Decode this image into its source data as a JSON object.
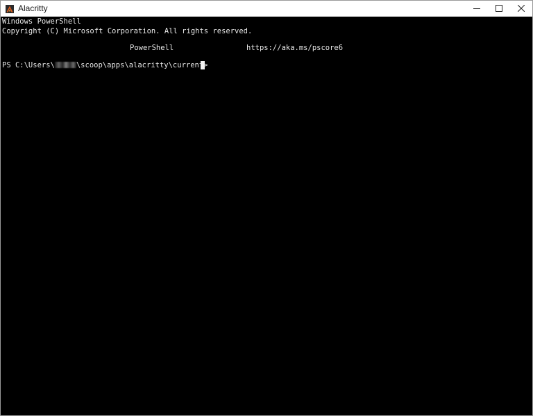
{
  "window": {
    "title": "Alacritty",
    "controls": {
      "minimize_icon": "minimize-icon",
      "maximize_icon": "maximize-icon",
      "close_icon": "close-icon"
    },
    "app_icon": "alacritty-logo-icon",
    "accent_color": "#e05c1e"
  },
  "terminal": {
    "background": "#000000",
    "foreground": "#e8e8e8",
    "lines": {
      "line1": "Windows PowerShell",
      "line2": "Copyright (C) Microsoft Corporation. All rights reserved.",
      "line3_left": "PowerShell",
      "line3_right": "https://aka.ms/pscore6",
      "prompt_prefix": "PS C:\\Users\\",
      "prompt_suffix": "\\scoop\\apps\\alacritty\\current>"
    }
  }
}
